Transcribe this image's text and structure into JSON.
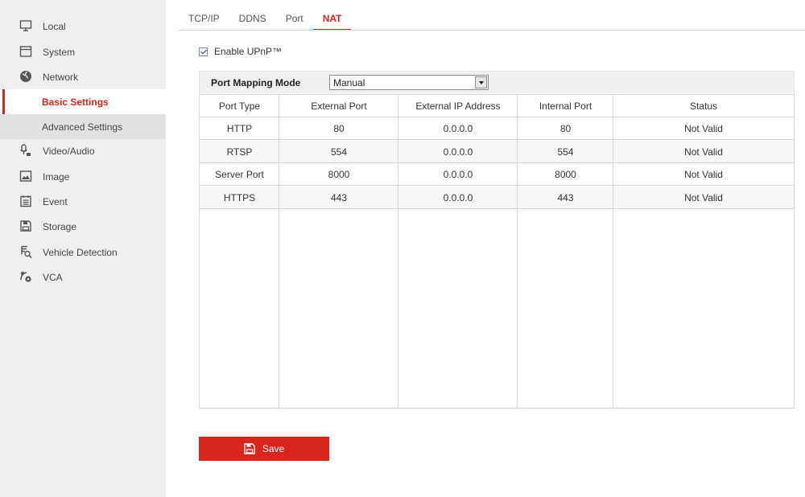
{
  "sidebar": {
    "items": [
      {
        "label": "Local",
        "icon": "monitor-icon"
      },
      {
        "label": "System",
        "icon": "window-icon"
      },
      {
        "label": "Network",
        "icon": "globe-icon"
      },
      {
        "label": "Video/Audio",
        "icon": "microphone-camera-icon"
      },
      {
        "label": "Image",
        "icon": "image-icon"
      },
      {
        "label": "Event",
        "icon": "calendar-icon"
      },
      {
        "label": "Storage",
        "icon": "floppy-disk-icon"
      },
      {
        "label": "Vehicle Detection",
        "icon": "vehicle-search-icon"
      },
      {
        "label": "VCA",
        "icon": "analytics-gear-icon"
      }
    ],
    "network_sub": [
      {
        "label": "Basic Settings",
        "active": true
      },
      {
        "label": "Advanced Settings",
        "active": false
      }
    ]
  },
  "tabs": [
    {
      "label": "TCP/IP",
      "active": false
    },
    {
      "label": "DDNS",
      "active": false
    },
    {
      "label": "Port",
      "active": false
    },
    {
      "label": "NAT",
      "active": true
    }
  ],
  "upnp": {
    "label": "Enable UPnP™",
    "checked": true
  },
  "mapping": {
    "label": "Port Mapping Mode",
    "value": "Manual"
  },
  "table": {
    "headers": [
      "Port Type",
      "External Port",
      "External IP Address",
      "Internal Port",
      "Status"
    ],
    "rows": [
      [
        "HTTP",
        "80",
        "0.0.0.0",
        "80",
        "Not Valid"
      ],
      [
        "RTSP",
        "554",
        "0.0.0.0",
        "554",
        "Not Valid"
      ],
      [
        "Server Port",
        "8000",
        "0.0.0.0",
        "8000",
        "Not Valid"
      ],
      [
        "HTTPS",
        "443",
        "0.0.0.0",
        "443",
        "Not Valid"
      ]
    ]
  },
  "save": {
    "label": "Save",
    "icon": "floppy-disk-icon"
  },
  "colors": {
    "accent": "#d9251c",
    "sidebar_bg": "#efefef"
  }
}
